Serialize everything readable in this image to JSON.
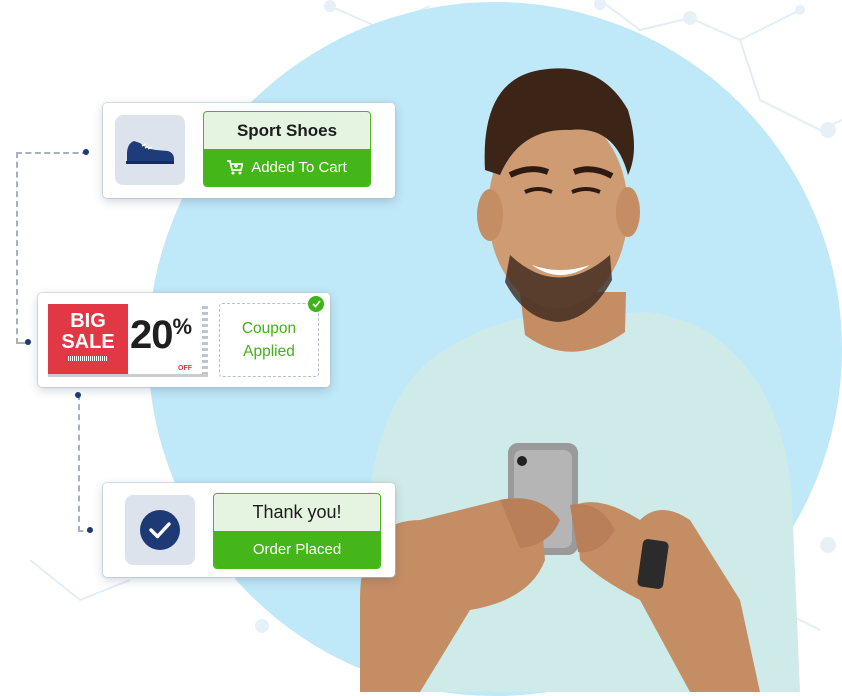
{
  "cards": {
    "cart": {
      "title": "Sport Shoes",
      "status": "Added To Cart"
    },
    "coupon": {
      "sale_line1": "BIG",
      "sale_line2": "SALE",
      "discount_number": "20",
      "discount_symbol": "%",
      "discount_off": "OFF",
      "applied_line1": "Coupon",
      "applied_line2": "Applied"
    },
    "order": {
      "title": "Thank you!",
      "status": "Order Placed"
    }
  },
  "colors": {
    "backdrop_circle": "#bfe8f8",
    "accent_green": "#45b619",
    "sale_red": "#e23845",
    "navy": "#1d3a74"
  },
  "icons": {
    "shoe": "sneaker-icon",
    "cart": "shopping-cart-icon",
    "order": "check-circle-icon",
    "badge": "check-badge-icon"
  }
}
